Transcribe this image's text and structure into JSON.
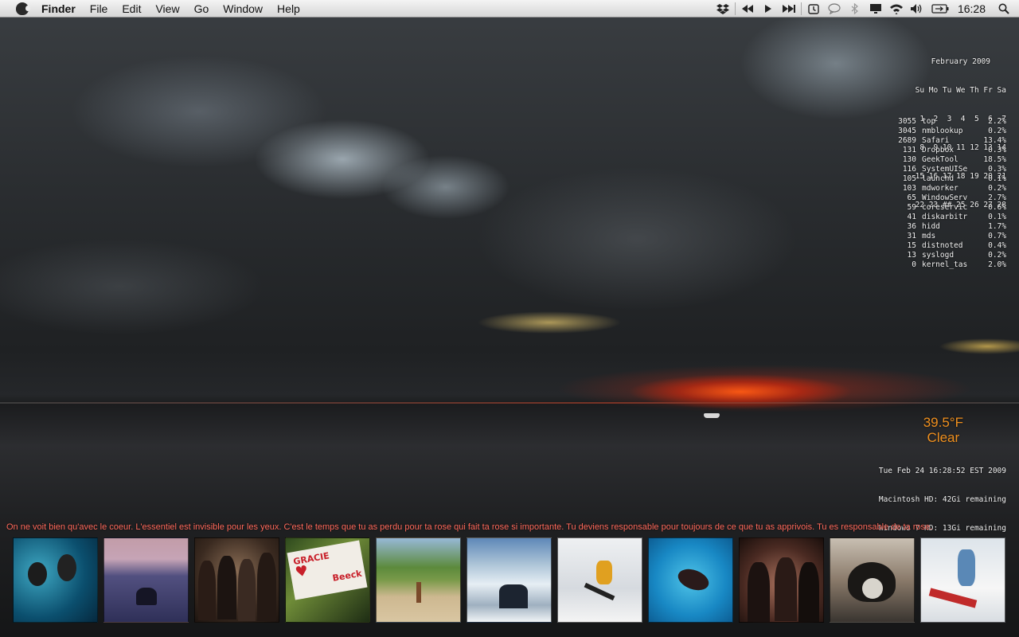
{
  "menubar": {
    "app_name": "Finder",
    "menus": [
      "File",
      "Edit",
      "View",
      "Go",
      "Window",
      "Help"
    ],
    "clock": "16:28",
    "status_icons": [
      "dropbox-icon",
      "rewind-icon",
      "play-icon",
      "fast-forward-icon",
      "time-machine-icon",
      "speech-icon",
      "bluetooth-icon",
      "display-icon",
      "wifi-icon",
      "volume-icon",
      "battery-icon",
      "spotlight-icon"
    ]
  },
  "calendar": {
    "title": "February 2009",
    "header": "Su Mo Tu We Th Fr Sa",
    "rows": [
      " 1  2  3  4  5  6  7",
      " 8  9 10 11 12 13 14",
      "15 16 17 18 19 20 21",
      "22 23 ## 25 26 27 28"
    ]
  },
  "processes": [
    {
      "pid": "3055",
      "name": "top",
      "cpu": "2.2%"
    },
    {
      "pid": "3045",
      "name": "nmblookup",
      "cpu": "0.2%"
    },
    {
      "pid": "2689",
      "name": "Safari",
      "cpu": "13.4%"
    },
    {
      "pid": "131",
      "name": "Dropbox",
      "cpu": "0.3%"
    },
    {
      "pid": "130",
      "name": "GeekTool",
      "cpu": "18.5%"
    },
    {
      "pid": "116",
      "name": "SystemUISe",
      "cpu": "0.3%"
    },
    {
      "pid": "105",
      "name": "launchd",
      "cpu": "0.1%"
    },
    {
      "pid": "103",
      "name": "mdworker",
      "cpu": "0.2%"
    },
    {
      "pid": "65",
      "name": "WindowServ",
      "cpu": "2.7%"
    },
    {
      "pid": "59",
      "name": "coreservic",
      "cpu": "0.6%"
    },
    {
      "pid": "41",
      "name": "diskarbitr",
      "cpu": "0.1%"
    },
    {
      "pid": "36",
      "name": "hidd",
      "cpu": "1.7%"
    },
    {
      "pid": "31",
      "name": "mds",
      "cpu": "0.7%"
    },
    {
      "pid": "15",
      "name": "distnoted",
      "cpu": "0.4%"
    },
    {
      "pid": "13",
      "name": "syslogd",
      "cpu": "0.2%"
    },
    {
      "pid": "0",
      "name": "kernel_tas",
      "cpu": "2.0%"
    }
  ],
  "weather": {
    "temperature": "39.5°F",
    "condition": "Clear"
  },
  "sysinfo": {
    "datetime": "Tue Feb 24 16:28:52 EST 2009",
    "macintosh_hd": "Macintosh HD: 42Gi remaining",
    "windows_hd": "Windows 7 HD: 13Gi remaining"
  },
  "quote": "On ne voit bien qu'avec le coeur. L'essentiel est invisible pour les yeux. C'est le temps que tu as perdu pour ta rose qui fait ta rose si importante. Tu deviens responsable pour toujours de ce que tu as apprivois. Tu es responsable de ta rose.",
  "photos": {
    "count": 11,
    "sign_text_1": "GRACIE",
    "sign_text_2": "Beeck"
  },
  "colors": {
    "weather_text": "#f0901e",
    "quote_text": "#ff6a5c",
    "overlay_text": "#f2f2f2"
  }
}
